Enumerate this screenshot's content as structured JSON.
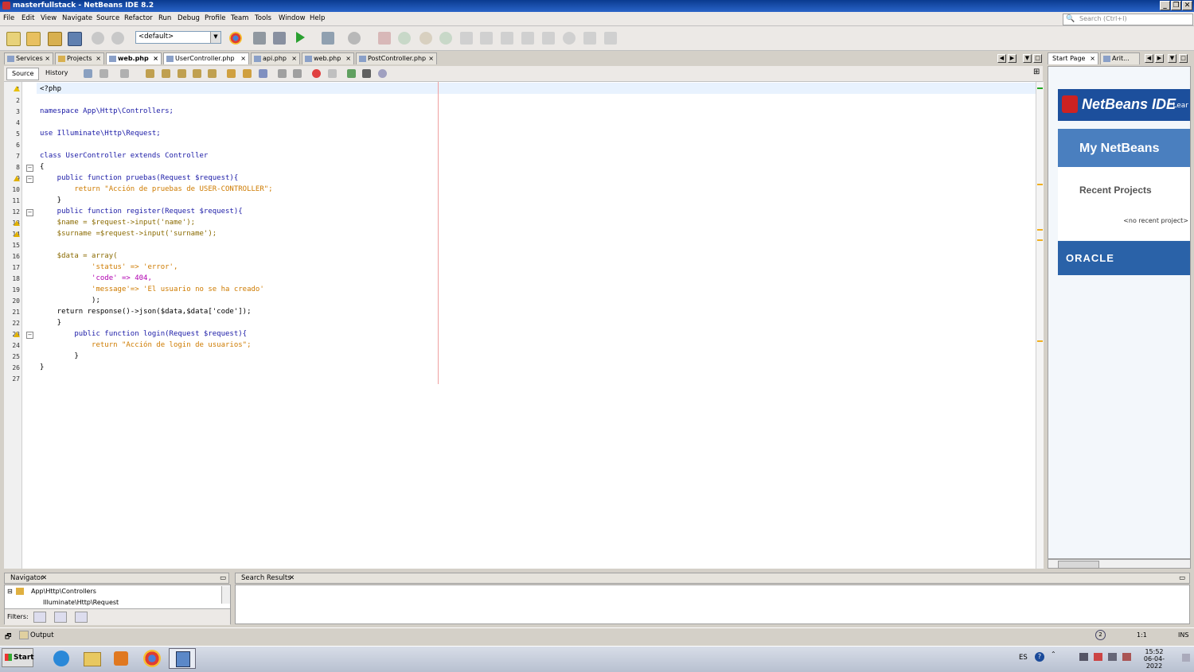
{
  "window": {
    "title": "masterfullstack - NetBeans IDE 8.2"
  },
  "menu": [
    "File",
    "Edit",
    "View",
    "Navigate",
    "Source",
    "Refactor",
    "Run",
    "Debug",
    "Profile",
    "Team",
    "Tools",
    "Window",
    "Help"
  ],
  "search": {
    "placeholder": "Search (Ctrl+I)"
  },
  "toolbar": {
    "config_value": "<default>"
  },
  "tabs": [
    {
      "label": "Services"
    },
    {
      "label": "Projects"
    },
    {
      "label": "web.php"
    },
    {
      "label": "UserController.php"
    },
    {
      "label": "api.php"
    },
    {
      "label": "web.php"
    },
    {
      "label": "PostController.php"
    }
  ],
  "editor": {
    "source_tab": "Source",
    "history_tab": "History",
    "lines": [
      {
        "n": "1",
        "t": "<?php"
      },
      {
        "n": "2",
        "t": ""
      },
      {
        "n": "3",
        "t": "namespace App\\Http\\Controllers;"
      },
      {
        "n": "4",
        "t": ""
      },
      {
        "n": "5",
        "t": "use Illuminate\\Http\\Request;"
      },
      {
        "n": "6",
        "t": ""
      },
      {
        "n": "7",
        "t": "class UserController extends Controller"
      },
      {
        "n": "8",
        "t": "{"
      },
      {
        "n": "9",
        "t": "    public function pruebas(Request $request){"
      },
      {
        "n": "10",
        "t": "        return \"Acción de pruebas de USER-CONTROLLER\";"
      },
      {
        "n": "11",
        "t": "    }"
      },
      {
        "n": "12",
        "t": "    public function register(Request $request){"
      },
      {
        "n": "13",
        "t": "    $name = $request->input('name');"
      },
      {
        "n": "14",
        "t": "    $surname =$request->input('surname');"
      },
      {
        "n": "15",
        "t": ""
      },
      {
        "n": "16",
        "t": "    $data = array("
      },
      {
        "n": "17",
        "t": "            'status' => 'error',"
      },
      {
        "n": "18",
        "t": "            'code' => 404,"
      },
      {
        "n": "19",
        "t": "            'message'=> 'El usuario no se ha creado'"
      },
      {
        "n": "20",
        "t": "            );"
      },
      {
        "n": "21",
        "t": "    return response()->json($data,$data['code']);"
      },
      {
        "n": "22",
        "t": "    }"
      },
      {
        "n": "23",
        "t": "        public function login(Request $request){"
      },
      {
        "n": "24",
        "t": "            return \"Acción de login de usuarios\";"
      },
      {
        "n": "25",
        "t": "        }"
      },
      {
        "n": "26",
        "t": "}"
      },
      {
        "n": "27",
        "t": ""
      }
    ]
  },
  "start_page": {
    "tab_label": "Start Page",
    "tab2_label": "Arit...",
    "logo": "NetBeans IDE",
    "learn": "Lear",
    "my_netbeans": "My NetBeans",
    "recent_projects": "Recent Projects",
    "no_recent": "<no recent project>",
    "oracle": "ORACLE"
  },
  "navigator": {
    "title": "Navigator",
    "tree": [
      "App\\Http\\Controllers",
      "Illuminate\\Http\\Request"
    ],
    "filters_label": "Filters:"
  },
  "search_results": {
    "title": "Search Results"
  },
  "status": {
    "output": "Output",
    "position": "1:1",
    "mode": "INS"
  },
  "taskbar": {
    "start": "Start",
    "lang": "ES",
    "time": "15:52",
    "date": "06-04-2022"
  }
}
